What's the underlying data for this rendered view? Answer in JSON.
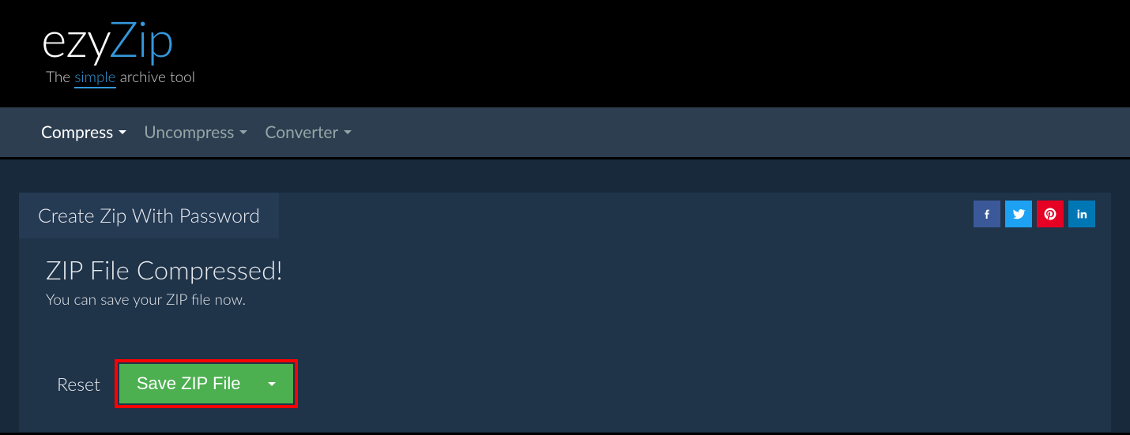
{
  "brand": {
    "part1": "ezy",
    "part2": "Zip",
    "tagline_pre": "The ",
    "tagline_highlight": "simple",
    "tagline_post": " archive tool"
  },
  "nav": {
    "compress": "Compress",
    "uncompress": "Uncompress",
    "converter": "Converter"
  },
  "panel": {
    "tab_title": "Create Zip With Password",
    "status_title": "ZIP File Compressed!",
    "status_sub": "You can save your ZIP file now."
  },
  "actions": {
    "reset": "Reset",
    "save": "Save ZIP File"
  },
  "social": {
    "facebook": "facebook",
    "twitter": "twitter",
    "pinterest": "pinterest",
    "linkedin": "linkedin"
  }
}
